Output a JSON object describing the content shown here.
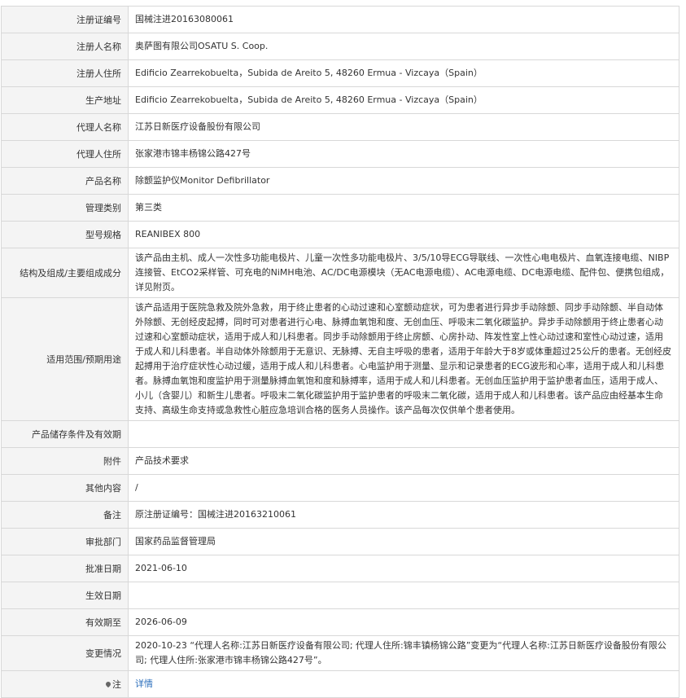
{
  "rows": [
    {
      "label": "注册证编号",
      "value": "国械注进20163080061"
    },
    {
      "label": "注册人名称",
      "value": "奥萨图有限公司OSATU S. Coop."
    },
    {
      "label": "注册人住所",
      "value": "Edificio Zearrekobuelta，Subida de Areito 5, 48260 Ermua - Vizcaya（Spain）"
    },
    {
      "label": "生产地址",
      "value": "Edificio Zearrekobuelta，Subida de Areito 5, 48260 Ermua - Vizcaya（Spain）"
    },
    {
      "label": "代理人名称",
      "value": "江苏日新医疗设备股份有限公司"
    },
    {
      "label": "代理人住所",
      "value": "张家港市锦丰杨锦公路427号"
    },
    {
      "label": "产品名称",
      "value": "除颤监护仪Monitor Defibrillator"
    },
    {
      "label": "管理类别",
      "value": "第三类"
    },
    {
      "label": "型号规格",
      "value": "REANIBEX 800"
    },
    {
      "label": "结构及组成/主要组成成分",
      "value": "该产品由主机、成人一次性多功能电极片、儿童一次性多功能电极片、3/5/10导ECG导联线、一次性心电电极片、血氧连接电缆、NIBP连接管、EtCO2采样管、可充电的NiMH电池、AC/DC电源模块（无AC电源电缆）、AC电源电缆、DC电源电缆、配件包、便携包组成，详见附页。"
    },
    {
      "label": "适用范围/预期用途",
      "value": "该产品适用于医院急救及院外急救，用于终止患者的心动过速和心室颤动症状，可为患者进行异步手动除颤、同步手动除颤、半自动体外除颤、无创经皮起搏，同时可对患者进行心电、脉搏血氧饱和度、无创血压、呼吸末二氧化碳监护。异步手动除颤用于终止患者心动过速和心室颤动症状，适用于成人和儿科患者。同步手动除颤用于终止房颤、心房扑动、阵发性室上性心动过速和室性心动过速，适用于成人和儿科患者。半自动体外除颤用于无意识、无脉搏、无自主呼吸的患者，适用于年龄大于8岁或体重超过25公斤的患者。无创经皮起搏用于治疗症状性心动过缓，适用于成人和儿科患者。心电监护用于测量、显示和记录患者的ECG波形和心率，适用于成人和儿科患者。脉搏血氧饱和度监护用于测量脉搏血氧饱和度和脉搏率，适用于成人和儿科患者。无创血压监护用于监护患者血压，适用于成人、小儿（含婴儿）和新生儿患者。呼吸末二氧化碳监护用于监护患者的呼吸末二氧化碳，适用于成人和儿科患者。该产品应由经基本生命支持、高级生命支持或急救性心脏应急培训合格的医务人员操作。该产品每次仅供单个患者使用。"
    },
    {
      "label": "产品储存条件及有效期",
      "value": ""
    },
    {
      "label": "附件",
      "value": "产品技术要求"
    },
    {
      "label": "其他内容",
      "value": "/"
    },
    {
      "label": "备注",
      "value": "原注册证编号：国械注进20163210061"
    },
    {
      "label": "审批部门",
      "value": "国家药品监督管理局"
    },
    {
      "label": "批准日期",
      "value": "2021-06-10"
    },
    {
      "label": "生效日期",
      "value": ""
    },
    {
      "label": "有效期至",
      "value": "2026-06-09"
    },
    {
      "label": "变更情况",
      "value": "2020-10-23 “代理人名称:江苏日新医疗设备有限公司; 代理人住所:锦丰镇杨锦公路”变更为“代理人名称:江苏日新医疗设备股份有限公司; 代理人住所:张家港市锦丰杨锦公路427号”。"
    }
  ],
  "note": {
    "label": "注",
    "link": "详情",
    "icon": "map-pin-icon"
  }
}
